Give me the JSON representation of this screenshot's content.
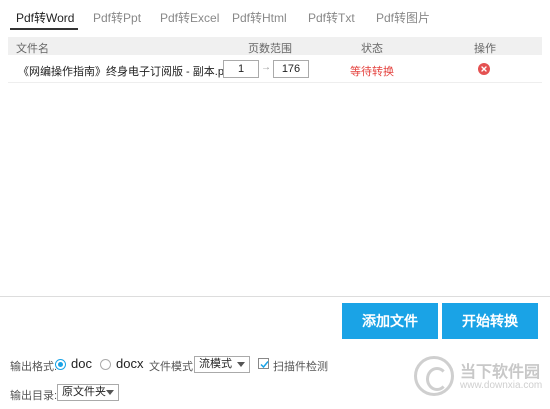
{
  "tabs": [
    {
      "label": "Pdf转Word",
      "active": true
    },
    {
      "label": "Pdf转Ppt",
      "active": false
    },
    {
      "label": "Pdf转Excel",
      "active": false
    },
    {
      "label": "Pdf转Html",
      "active": false
    },
    {
      "label": "Pdf转Txt",
      "active": false
    },
    {
      "label": "Pdf转图片",
      "active": false
    }
  ],
  "table": {
    "columns": [
      "文件名",
      "页数范围",
      "状态",
      "操作"
    ],
    "rows": [
      {
        "file_name": "《网编操作指南》终身电子订阅版 - 副本.pdf",
        "page_from": "1",
        "page_to": "176",
        "arrow": "→",
        "status": "等待转换",
        "action_icon": "close-circle-icon"
      }
    ]
  },
  "buttons": {
    "add_file": "添加文件",
    "start_convert": "开始转换"
  },
  "options": {
    "format_label": "输出格式:",
    "format_options": [
      "doc",
      "docx"
    ],
    "format_selected": "doc",
    "mode_label": "文件模式:",
    "mode_value": "流模式",
    "scan_checkbox_label": "扫描件检测",
    "scan_checked": true,
    "output_dir_label": "输出目录:",
    "output_dir_value": "原文件夹"
  },
  "watermark": {
    "text": "当下软件园",
    "url": "www.downxia.com"
  },
  "colors": {
    "accent": "#1aa3e6",
    "status": "#e4413d",
    "delete": "#e45151"
  }
}
